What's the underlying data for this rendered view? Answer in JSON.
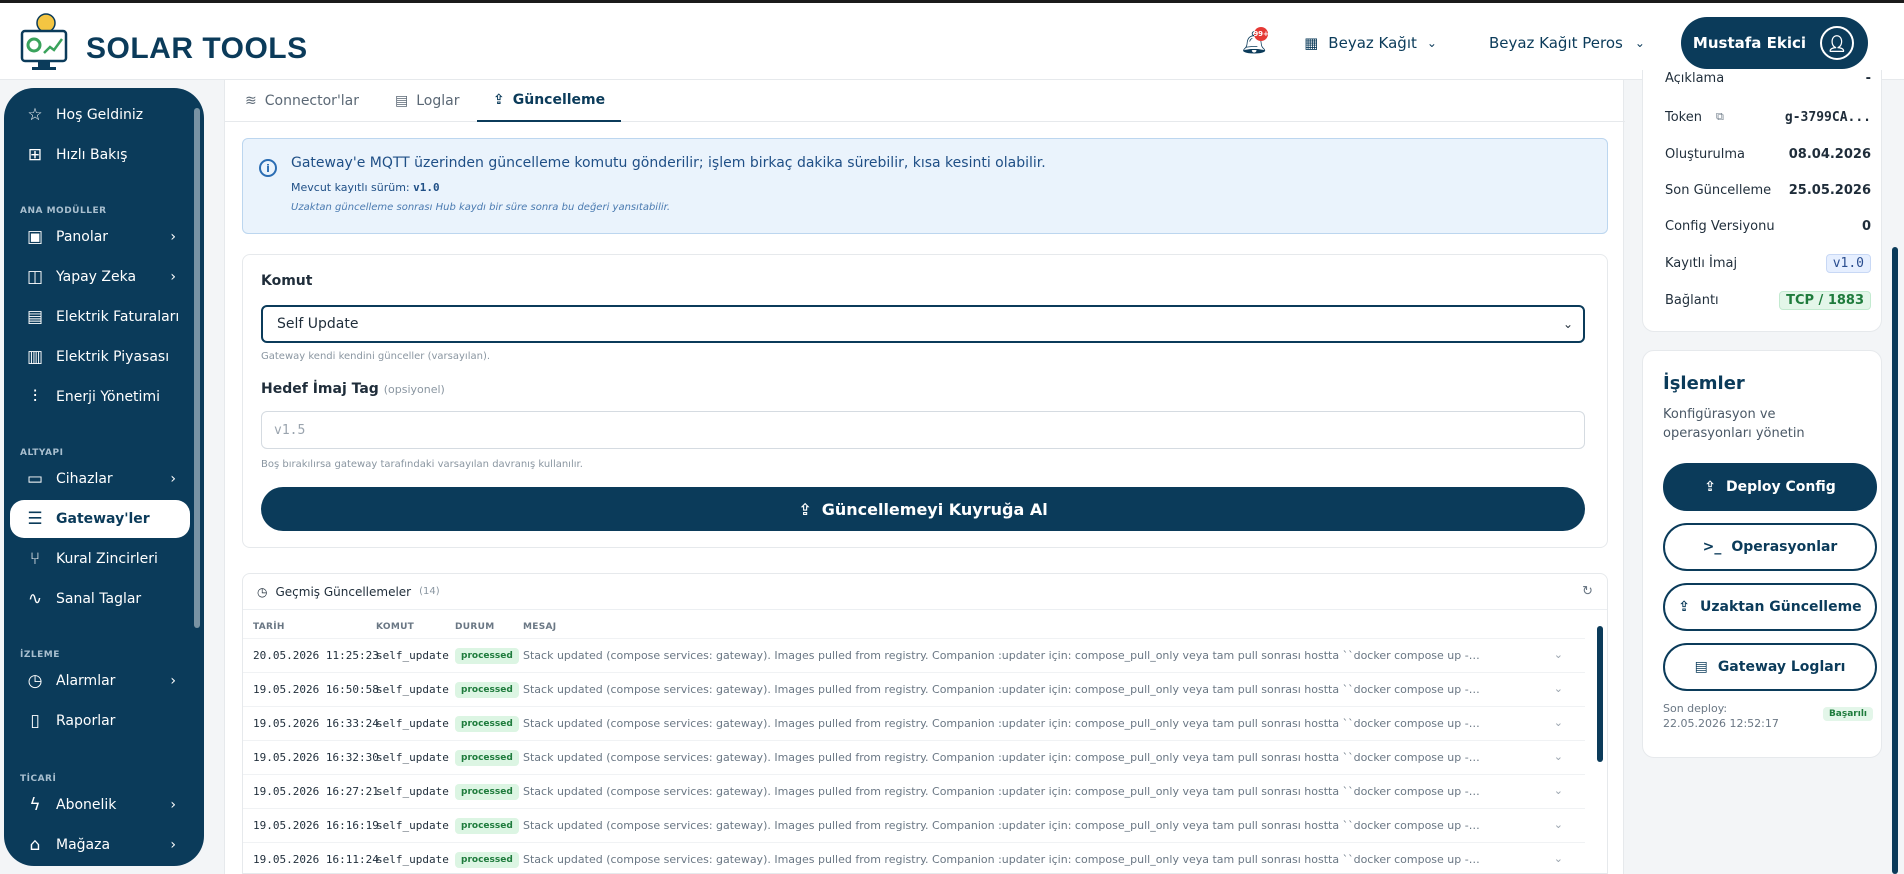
{
  "header": {
    "brand": "SOLAR TOOLS",
    "notification_count": "99+",
    "org": "Beyaz Kağıt",
    "sub_org": "Beyaz Kağıt Peros",
    "user": "Mustafa Ekici"
  },
  "sidebar": {
    "items": [
      {
        "label": "Hoş Geldiniz",
        "icon": "star-icon"
      },
      {
        "label": "Hızlı Bakış",
        "icon": "grid-icon"
      },
      {
        "label": "Panolar",
        "icon": "dashboard-icon"
      },
      {
        "label": "Yapay Zeka",
        "icon": "ai-icon"
      },
      {
        "label": "Elektrik Faturaları",
        "icon": "invoice-icon"
      },
      {
        "label": "Elektrik Piyasası",
        "icon": "building-icon"
      },
      {
        "label": "Enerji Yönetimi",
        "icon": "sliders-icon"
      },
      {
        "label": "Cihazlar",
        "icon": "monitor-icon"
      },
      {
        "label": "Gateway'ler",
        "icon": "server-icon"
      },
      {
        "label": "Kural Zincirleri",
        "icon": "branch-icon"
      },
      {
        "label": "Sanal Taglar",
        "icon": "activity-icon"
      },
      {
        "label": "Alarmlar",
        "icon": "alarm-icon"
      },
      {
        "label": "Raporlar",
        "icon": "report-icon"
      },
      {
        "label": "Abonelik",
        "icon": "bolt-icon"
      },
      {
        "label": "Mağaza",
        "icon": "store-icon"
      }
    ],
    "sections": {
      "ana": "ANA MODÜLLER",
      "altyapi": "ALTYAPI",
      "izleme": "İZLEME",
      "ticari": "TİCARİ"
    }
  },
  "tabs": [
    {
      "label": "Connector'lar"
    },
    {
      "label": "Loglar"
    },
    {
      "label": "Güncelleme"
    }
  ],
  "info": {
    "main": "Gateway'e MQTT üzerinden güncelleme komutu gönderilir; işlem birkaç dakika sürebilir, kısa kesinti olabilir.",
    "current_label": "Mevcut kayıtlı sürüm:",
    "current_version": "v1.0",
    "note": "Uzaktan güncelleme sonrası Hub kaydı bir süre sonra bu değeri yansıtabilir."
  },
  "form": {
    "command_label": "Komut",
    "command_value": "Self Update",
    "command_help": "Gateway kendi kendini günceller (varsayılan).",
    "tag_label": "Hedef İmaj Tag",
    "tag_optional": "(opsiyonel)",
    "tag_placeholder": "v1.5",
    "tag_help": "Boş bırakılırsa gateway tarafındaki varsayılan davranış kullanılır.",
    "submit": "Güncellemeyi Kuyruğa Al"
  },
  "history": {
    "title": "Geçmiş Güncellemeler",
    "count": "(14)",
    "columns": [
      "TARİH",
      "KOMUT",
      "DURUM",
      "MESAJ"
    ],
    "rows": [
      {
        "date": "20.05.2026 11:25:23",
        "cmd": "self_update",
        "status": "processed",
        "msg": "Stack updated (compose services: gateway). Images pulled from registry. Companion :updater için: compose_pull_only veya tam pull sonrası hostta ``docker compose up -d updater``."
      },
      {
        "date": "19.05.2026 16:50:58",
        "cmd": "self_update",
        "status": "processed",
        "msg": "Stack updated (compose services: gateway). Images pulled from registry. Companion :updater için: compose_pull_only veya tam pull sonrası hostta ``docker compose up -d updater``."
      },
      {
        "date": "19.05.2026 16:33:24",
        "cmd": "self_update",
        "status": "processed",
        "msg": "Stack updated (compose services: gateway). Images pulled from registry. Companion :updater için: compose_pull_only veya tam pull sonrası hostta ``docker compose up -d updater``."
      },
      {
        "date": "19.05.2026 16:32:30",
        "cmd": "self_update",
        "status": "processed",
        "msg": "Stack updated (compose services: gateway). Images pulled from registry. Companion :updater için: compose_pull_only veya tam pull sonrası hostta ``docker compose up -d updater``."
      },
      {
        "date": "19.05.2026 16:27:21",
        "cmd": "self_update",
        "status": "processed",
        "msg": "Stack updated (compose services: gateway). Images pulled from registry. Companion :updater için: compose_pull_only veya tam pull sonrası hostta ``docker compose up -d updater``."
      },
      {
        "date": "19.05.2026 16:16:19",
        "cmd": "self_update",
        "status": "processed",
        "msg": "Stack updated (compose services: gateway). Images pulled from registry. Companion :updater için: compose_pull_only veya tam pull sonrası hostta ``docker compose up -d updater``."
      },
      {
        "date": "19.05.2026 16:11:24",
        "cmd": "self_update",
        "status": "processed",
        "msg": "Stack updated (compose services: gateway). Images pulled from registry. Companion :updater için: compose_pull_only veya tam pull sonrası hostta ``docker compose up -d updater``."
      }
    ]
  },
  "meta": {
    "aciklama_label": "Açıklama",
    "aciklama_value": "-",
    "token_label": "Token",
    "token_value": "g-3799CA...",
    "created_label": "Oluşturulma",
    "created_value": "08.04.2026",
    "updated_label": "Son Güncelleme",
    "updated_value": "25.05.2026",
    "config_label": "Config Versiyonu",
    "config_value": "0",
    "image_label": "Kayıtlı İmaj",
    "image_value": "v1.0",
    "conn_label": "Bağlantı",
    "conn_value": "TCP / 1883"
  },
  "ops": {
    "title": "İşlemler",
    "subtitle": "Konfigürasyon ve operasyonları yönetin",
    "deploy": "Deploy Config",
    "operations": "Operasyonlar",
    "remote_update": "Uzaktan Güncelleme",
    "logs": "Gateway Logları",
    "last_deploy": "Son deploy: 22.05.2026 12:52:17",
    "last_status": "Başarılı"
  },
  "colors": {
    "primary": "#0b3b5a",
    "success": "#1e7b3c",
    "info": "#1f4f86"
  }
}
